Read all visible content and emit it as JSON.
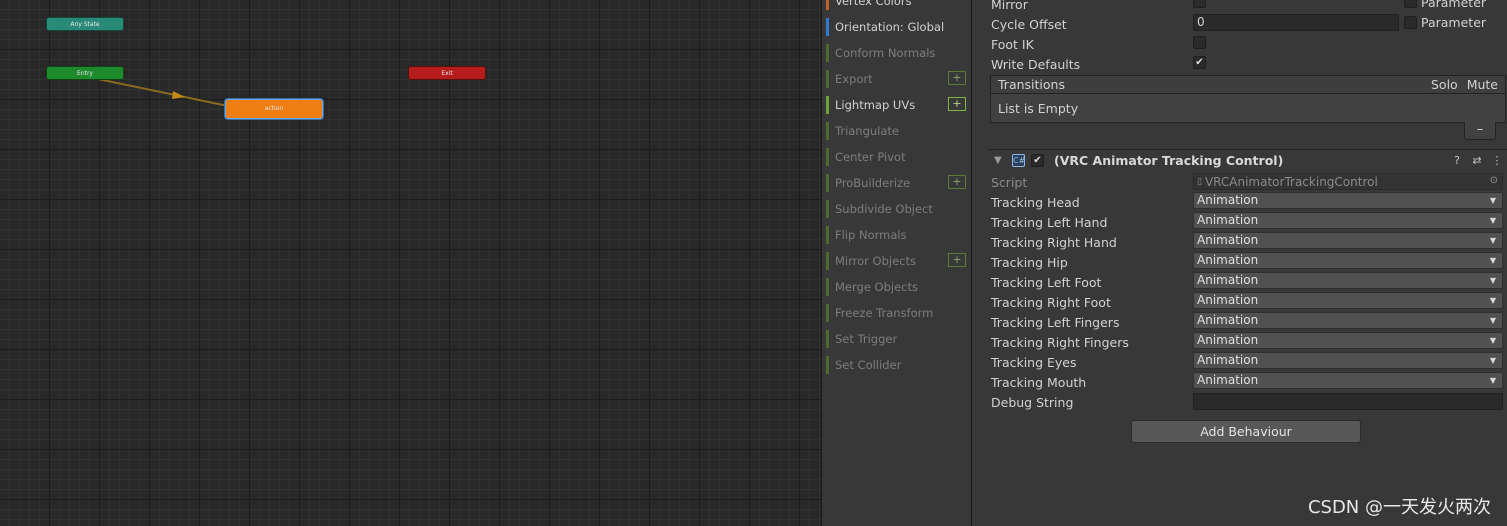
{
  "graph": {
    "nodes": {
      "any_state": "Any State",
      "entry": "Entry",
      "exit": "Exit",
      "action": "action"
    }
  },
  "toolbar": {
    "items": [
      {
        "label": "Vertex Colors",
        "state": "enabled",
        "bar_color": "#c0622b",
        "plus": false
      },
      {
        "label": "Orientation: Global",
        "state": "enabled",
        "bar_color": "#2e7bd1",
        "plus": false
      },
      {
        "label": "Conform Normals",
        "state": "disabled",
        "plus": false
      },
      {
        "label": "Export",
        "state": "disabled",
        "plus": true
      },
      {
        "label": "Lightmap UVs",
        "state": "enabled",
        "plus": true
      },
      {
        "label": "Triangulate",
        "state": "disabled",
        "plus": false
      },
      {
        "label": "Center Pivot",
        "state": "disabled",
        "plus": false
      },
      {
        "label": "ProBuilderize",
        "state": "disabled",
        "plus": true
      },
      {
        "label": "Subdivide Object",
        "state": "disabled",
        "plus": false
      },
      {
        "label": "Flip Normals",
        "state": "disabled",
        "plus": false
      },
      {
        "label": "Mirror Objects",
        "state": "disabled",
        "plus": true
      },
      {
        "label": "Merge Objects",
        "state": "disabled",
        "plus": false
      },
      {
        "label": "Freeze Transform",
        "state": "disabled",
        "plus": false
      },
      {
        "label": "Set Trigger",
        "state": "disabled",
        "plus": false
      },
      {
        "label": "Set Collider",
        "state": "disabled",
        "plus": false
      }
    ],
    "plus_glyph": "+"
  },
  "inspector": {
    "mirror_label": "Mirror",
    "mirror_param_label": "Parameter",
    "cycle_offset_label": "Cycle Offset",
    "cycle_offset_value": "0",
    "cycle_param_label": "Parameter",
    "foot_ik_label": "Foot IK",
    "write_defaults_label": "Write Defaults",
    "write_defaults_check": "✔",
    "transitions": {
      "title": "Transitions",
      "solo": "Solo",
      "mute": "Mute",
      "empty": "List is Empty",
      "minus": "–"
    },
    "component": {
      "icon_glyph": "C#",
      "enabled_check": "✔",
      "title": "(VRC Animator Tracking Control)",
      "help_glyph": "?",
      "settings_glyph": "⇄",
      "menu_glyph": "⋮",
      "foldout_glyph": "▼"
    },
    "script_label": "Script",
    "script_value": "VRCAnimatorTrackingControl",
    "script_file_glyph": "▯",
    "script_target_glyph": "⊙",
    "tracking_rows": [
      {
        "label": "Tracking Head",
        "value": "Animation"
      },
      {
        "label": "Tracking Left Hand",
        "value": "Animation"
      },
      {
        "label": "Tracking Right Hand",
        "value": "Animation"
      },
      {
        "label": "Tracking Hip",
        "value": "Animation"
      },
      {
        "label": "Tracking Left Foot",
        "value": "Animation"
      },
      {
        "label": "Tracking Right Foot",
        "value": "Animation"
      },
      {
        "label": "Tracking Left Fingers",
        "value": "Animation"
      },
      {
        "label": "Tracking Right Fingers",
        "value": "Animation"
      },
      {
        "label": "Tracking Eyes",
        "value": "Animation"
      },
      {
        "label": "Tracking Mouth",
        "value": "Animation"
      }
    ],
    "dropdown_caret": "▼",
    "debug_string_label": "Debug String",
    "add_behaviour_label": "Add Behaviour"
  },
  "watermark": "CSDN @一天发火两次"
}
